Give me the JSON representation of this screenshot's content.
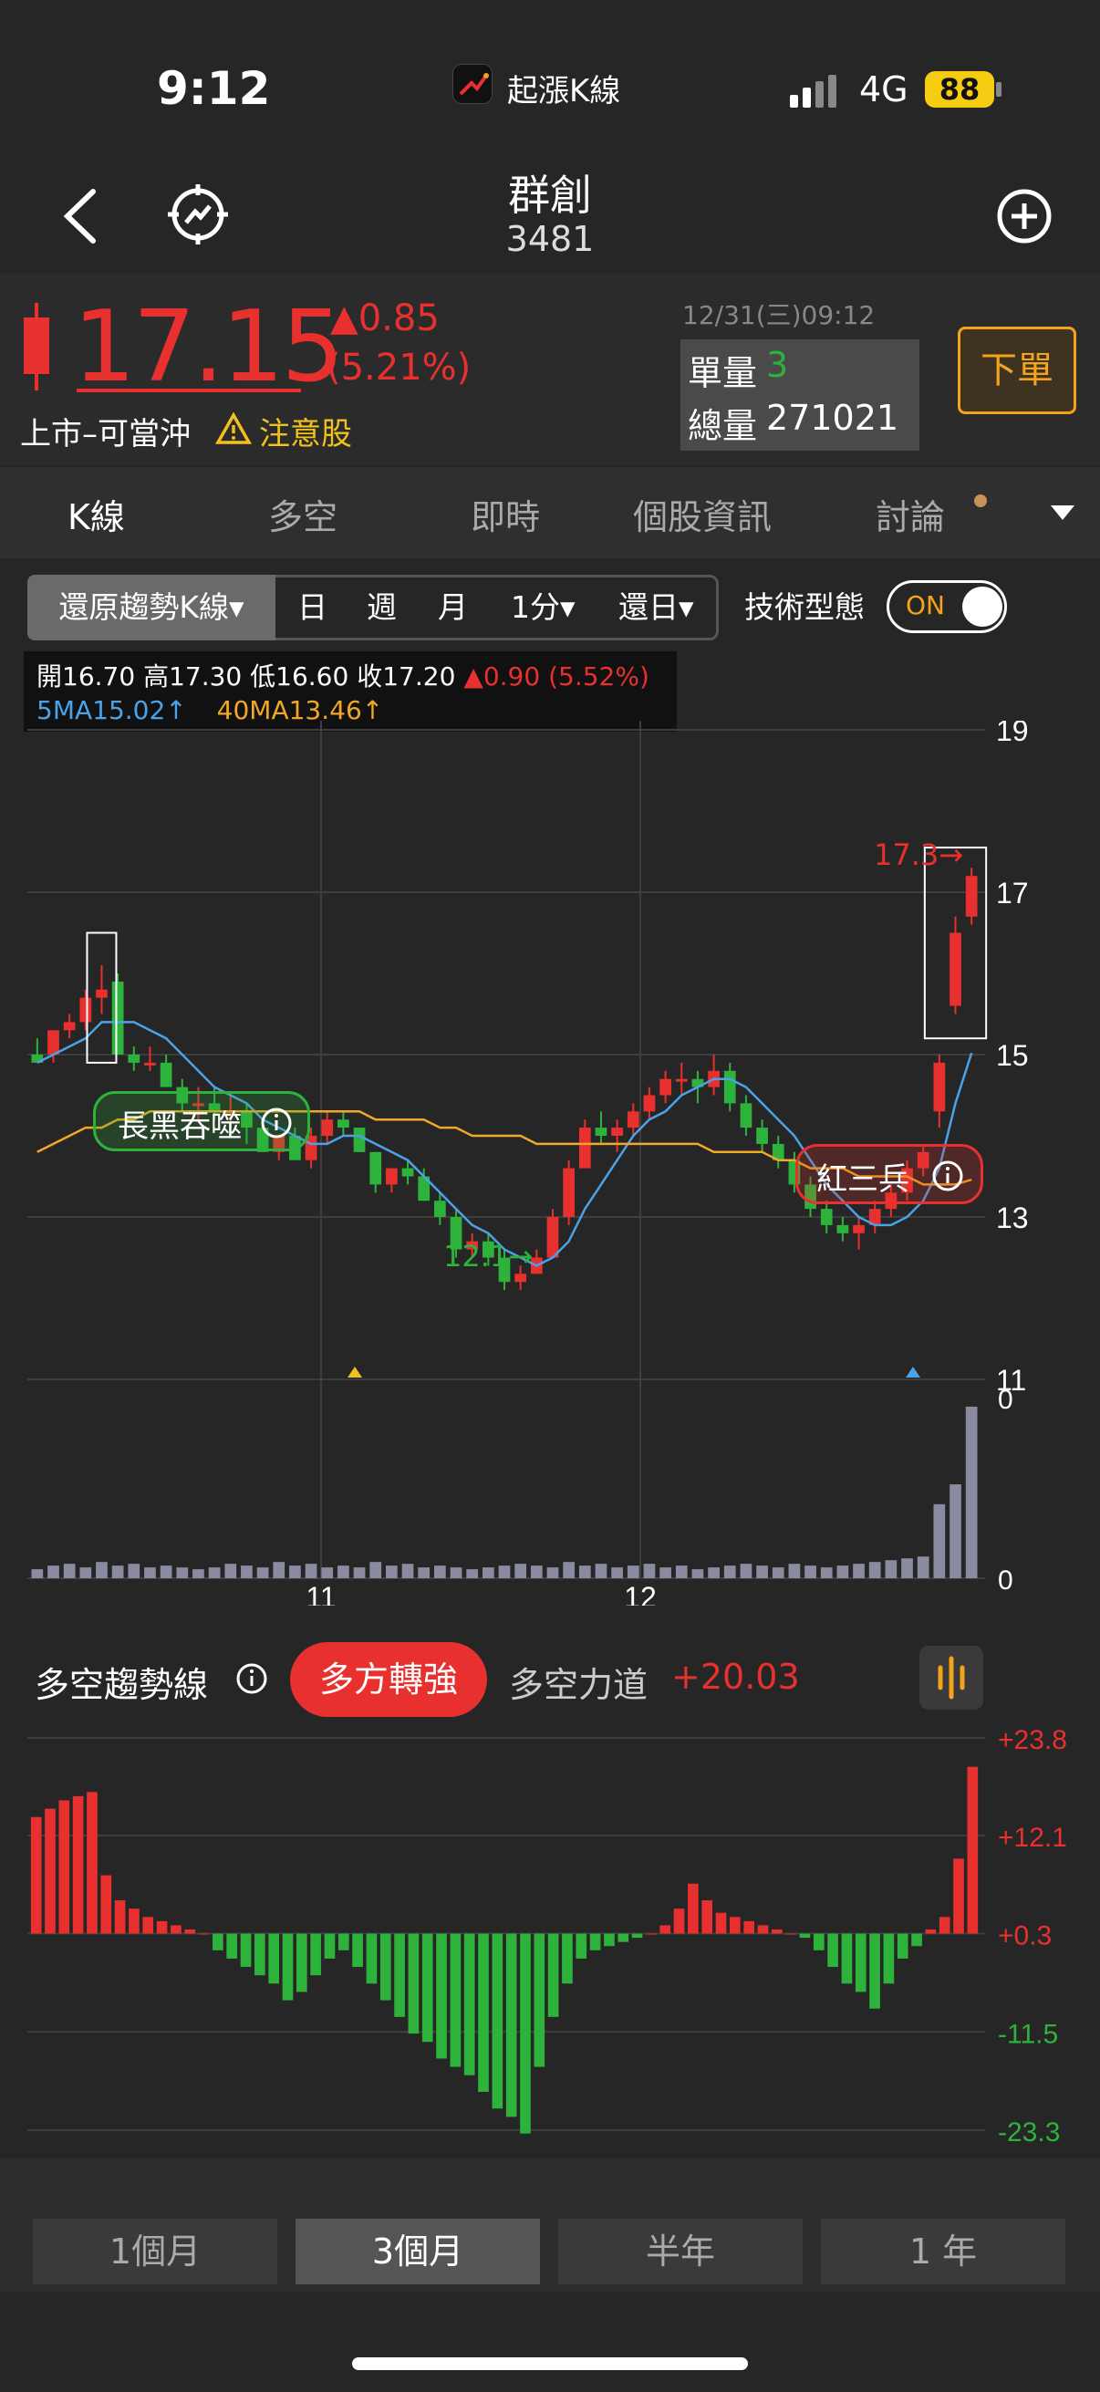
{
  "status": {
    "time": "9:12",
    "app_name": "起漲K線",
    "network": "4G",
    "battery": "88"
  },
  "header": {
    "title": "群創",
    "code": "3481"
  },
  "quote": {
    "price": "17.15",
    "change": "▲0.85",
    "change_pct": "(5.21%)",
    "board": "上市–可當沖",
    "warning": "注意股",
    "datetime": "12/31(三)09:12",
    "unit_vol_label": "單量",
    "unit_vol": "3",
    "total_vol_label": "總量",
    "total_vol": "271021",
    "order_button": "下單"
  },
  "tabs": [
    "K線",
    "多空",
    "即時",
    "個股資訊",
    "討論"
  ],
  "toolbar": {
    "chart_type": "還原趨勢K線▾",
    "periods": [
      "日",
      "週",
      "月",
      "1分▾",
      "還日▾"
    ],
    "pattern_label": "技術型態",
    "pattern_toggle": "ON"
  },
  "ohlc": {
    "open": "開16.70",
    "high": "高17.30",
    "low": "低16.60",
    "close": "收17.20",
    "change": "▲0.90 (5.52%)",
    "ma5": "5MA15.02↑",
    "ma40": "40MA13.46↑"
  },
  "annotations": {
    "bearish_engulfing": "長黑吞噬",
    "three_soldiers": "紅三兵",
    "low_marker": "12.1→",
    "high_marker": "17.3→"
  },
  "trend": {
    "title": "多空趨勢線",
    "signal": "多方轉強",
    "power_label": "多空力道",
    "power_value": "+20.03"
  },
  "period_buttons": [
    "1個月",
    "3個月",
    "半年",
    "1 年"
  ],
  "selected_period": "3個月",
  "colors": {
    "up": "#e8302f",
    "down": "#2db33c",
    "ma5": "#4aa3e8",
    "ma40": "#f0a826",
    "accent": "#f3a31c"
  },
  "chart_data": [
    {
      "type": "candlestick",
      "title": "",
      "x_tick_labels": [
        "11",
        "12"
      ],
      "y_ticks": [
        11,
        13,
        15,
        17,
        19
      ],
      "ylim": [
        11,
        19
      ],
      "series": [
        {
          "name": "K",
          "ohlc": [
            [
              15.0,
              15.2,
              14.9,
              14.9
            ],
            [
              15.0,
              15.3,
              14.9,
              15.3
            ],
            [
              15.3,
              15.5,
              15.2,
              15.4
            ],
            [
              15.4,
              15.8,
              15.3,
              15.7
            ],
            [
              15.7,
              16.1,
              15.5,
              15.8
            ],
            [
              15.9,
              16.0,
              15.0,
              15.0
            ],
            [
              15.0,
              15.1,
              14.8,
              14.9
            ],
            [
              14.9,
              15.1,
              14.8,
              14.9
            ],
            [
              14.9,
              15.0,
              14.6,
              14.6
            ],
            [
              14.6,
              14.7,
              14.3,
              14.4
            ],
            [
              14.4,
              14.6,
              14.2,
              14.4
            ],
            [
              14.4,
              14.6,
              14.2,
              14.3
            ],
            [
              14.3,
              14.5,
              14.1,
              14.3
            ],
            [
              14.3,
              14.4,
              13.9,
              14.1
            ],
            [
              14.1,
              14.2,
              13.8,
              13.8
            ],
            [
              13.8,
              14.0,
              13.7,
              14.0
            ],
            [
              14.0,
              14.1,
              13.7,
              13.7
            ],
            [
              13.7,
              14.1,
              13.6,
              14.0
            ],
            [
              14.0,
              14.3,
              13.9,
              14.2
            ],
            [
              14.2,
              14.3,
              14.0,
              14.1
            ],
            [
              14.1,
              14.1,
              13.8,
              13.8
            ],
            [
              13.8,
              13.8,
              13.3,
              13.4
            ],
            [
              13.4,
              13.6,
              13.3,
              13.6
            ],
            [
              13.6,
              13.7,
              13.4,
              13.5
            ],
            [
              13.5,
              13.6,
              13.2,
              13.2
            ],
            [
              13.2,
              13.3,
              12.9,
              13.0
            ],
            [
              13.0,
              13.1,
              12.5,
              12.6
            ],
            [
              12.6,
              12.8,
              12.5,
              12.7
            ],
            [
              12.7,
              12.8,
              12.4,
              12.5
            ],
            [
              12.5,
              12.6,
              12.1,
              12.2
            ],
            [
              12.2,
              12.4,
              12.1,
              12.3
            ],
            [
              12.3,
              12.6,
              12.3,
              12.5
            ],
            [
              12.5,
              13.1,
              12.5,
              13.0
            ],
            [
              13.0,
              13.7,
              12.9,
              13.6
            ],
            [
              13.6,
              14.2,
              13.6,
              14.1
            ],
            [
              14.1,
              14.3,
              13.9,
              14.0
            ],
            [
              14.0,
              14.2,
              13.8,
              14.1
            ],
            [
              14.1,
              14.4,
              14.0,
              14.3
            ],
            [
              14.3,
              14.6,
              14.2,
              14.5
            ],
            [
              14.5,
              14.8,
              14.4,
              14.7
            ],
            [
              14.7,
              14.9,
              14.5,
              14.7
            ],
            [
              14.7,
              14.8,
              14.4,
              14.6
            ],
            [
              14.6,
              15.0,
              14.5,
              14.8
            ],
            [
              14.8,
              14.9,
              14.3,
              14.4
            ],
            [
              14.4,
              14.5,
              14.0,
              14.1
            ],
            [
              14.1,
              14.2,
              13.8,
              13.9
            ],
            [
              13.9,
              14.0,
              13.6,
              13.7
            ],
            [
              13.7,
              13.8,
              13.3,
              13.4
            ],
            [
              13.4,
              13.5,
              13.0,
              13.1
            ],
            [
              13.1,
              13.2,
              12.8,
              12.9
            ],
            [
              12.9,
              13.0,
              12.7,
              12.8
            ],
            [
              12.8,
              13.0,
              12.6,
              12.9
            ],
            [
              12.9,
              13.2,
              12.8,
              13.1
            ],
            [
              13.1,
              13.4,
              13.0,
              13.3
            ],
            [
              13.3,
              13.7,
              13.2,
              13.6
            ],
            [
              13.6,
              13.9,
              13.5,
              13.8
            ],
            [
              14.3,
              15.0,
              14.1,
              14.9
            ],
            [
              15.6,
              16.7,
              15.5,
              16.5
            ],
            [
              16.7,
              17.3,
              16.6,
              17.2
            ]
          ]
        },
        {
          "name": "5MA",
          "values": [
            14.9,
            15.0,
            15.1,
            15.2,
            15.4,
            15.4,
            15.4,
            15.3,
            15.2,
            15.0,
            14.8,
            14.6,
            14.5,
            14.4,
            14.2,
            14.1,
            14.0,
            13.9,
            13.9,
            14.0,
            14.0,
            13.9,
            13.8,
            13.7,
            13.5,
            13.3,
            13.1,
            12.9,
            12.8,
            12.6,
            12.5,
            12.4,
            12.5,
            12.7,
            13.1,
            13.4,
            13.7,
            14.0,
            14.2,
            14.3,
            14.5,
            14.6,
            14.7,
            14.7,
            14.6,
            14.4,
            14.2,
            14.0,
            13.7,
            13.4,
            13.2,
            13.0,
            12.9,
            12.9,
            13.0,
            13.2,
            13.6,
            14.4,
            15.02
          ]
        },
        {
          "name": "40MA",
          "values": [
            13.8,
            13.9,
            14.0,
            14.1,
            14.1,
            14.2,
            14.2,
            14.3,
            14.3,
            14.3,
            14.3,
            14.3,
            14.3,
            14.3,
            14.3,
            14.3,
            14.3,
            14.3,
            14.3,
            14.3,
            14.3,
            14.2,
            14.2,
            14.2,
            14.2,
            14.1,
            14.1,
            14.0,
            14.0,
            14.0,
            14.0,
            13.9,
            13.9,
            13.9,
            13.9,
            13.9,
            13.9,
            13.9,
            13.9,
            13.9,
            13.9,
            13.9,
            13.8,
            13.8,
            13.8,
            13.8,
            13.7,
            13.7,
            13.6,
            13.6,
            13.6,
            13.5,
            13.5,
            13.5,
            13.5,
            13.4,
            13.4,
            13.4,
            13.46
          ]
        }
      ]
    },
    {
      "type": "bar",
      "title": "",
      "ylim": [
        0,
        100
      ],
      "values": [
        5,
        7,
        8,
        6,
        9,
        7,
        8,
        6,
        7,
        6,
        5,
        6,
        8,
        7,
        6,
        9,
        7,
        8,
        6,
        7,
        6,
        9,
        7,
        8,
        6,
        7,
        6,
        5,
        6,
        7,
        8,
        7,
        6,
        9,
        7,
        8,
        6,
        7,
        8,
        6,
        7,
        5,
        6,
        7,
        8,
        7,
        6,
        8,
        7,
        6,
        7,
        8,
        9,
        10,
        11,
        12,
        41,
        52,
        95
      ]
    },
    {
      "type": "bar",
      "title": "",
      "y_ticks": [
        -23.3,
        -11.5,
        0.3,
        12.1,
        23.8
      ],
      "ylim": [
        -23.3,
        23.8
      ],
      "values": [
        14,
        15,
        16,
        16.5,
        17,
        7,
        4,
        3,
        2,
        1.5,
        1,
        0.5,
        0,
        -2,
        -3,
        -4,
        -5,
        -6,
        -8,
        -7,
        -5,
        -3,
        -2,
        -4,
        -6,
        -8,
        -10,
        -12,
        -13,
        -15,
        -16,
        -17,
        -19,
        -21,
        -22,
        -24,
        -16,
        -10,
        -6,
        -3,
        -2,
        -1.5,
        -1,
        -0.5,
        0,
        1,
        3,
        6,
        4,
        2.5,
        2,
        1.5,
        1,
        0.5,
        0,
        -0.5,
        -2,
        -4,
        -6,
        -7,
        -9,
        -6,
        -3,
        -1.5,
        0.5,
        2,
        9,
        20.03
      ]
    }
  ]
}
